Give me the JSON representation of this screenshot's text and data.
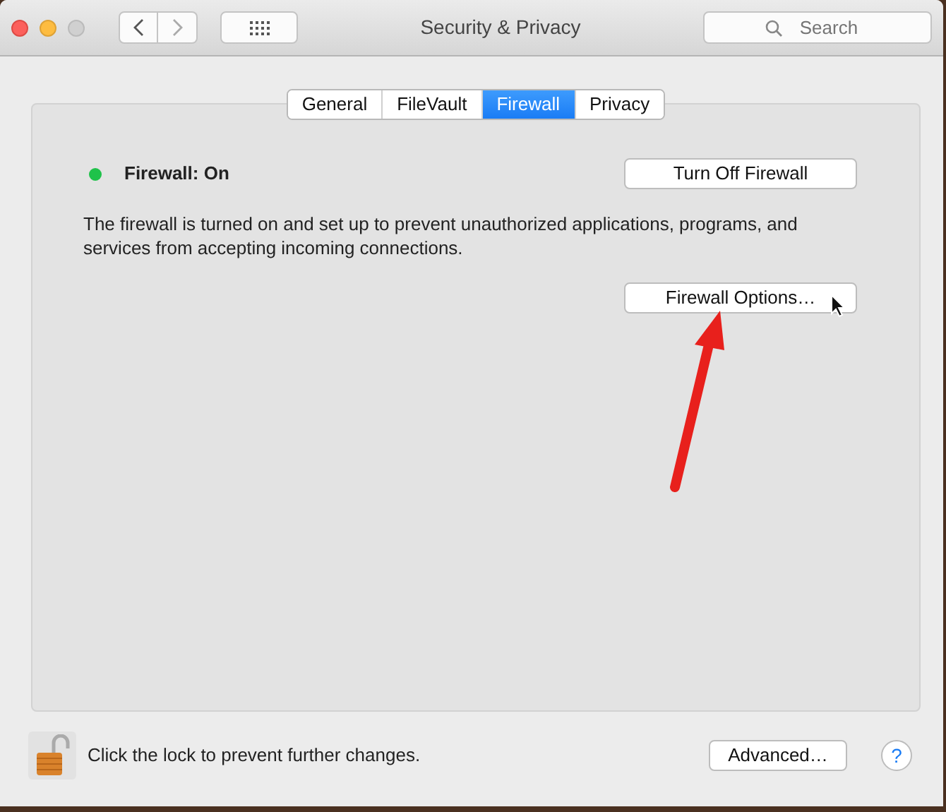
{
  "window": {
    "title": "Security & Privacy"
  },
  "search": {
    "placeholder": "Search"
  },
  "tabs": [
    {
      "label": "General",
      "selected": false
    },
    {
      "label": "FileVault",
      "selected": false
    },
    {
      "label": "Firewall",
      "selected": true
    },
    {
      "label": "Privacy",
      "selected": false
    }
  ],
  "firewall": {
    "status": "Firewall: On",
    "on": true,
    "toggle_button": "Turn Off Firewall",
    "description": "The firewall is turned on and set up to prevent unauthorized applications, programs, and services from accepting incoming connections.",
    "options_button": "Firewall Options…"
  },
  "footer": {
    "lock_text": "Click the lock to prevent further changes.",
    "locked": false,
    "advanced_button": "Advanced…",
    "help_button": "?"
  }
}
